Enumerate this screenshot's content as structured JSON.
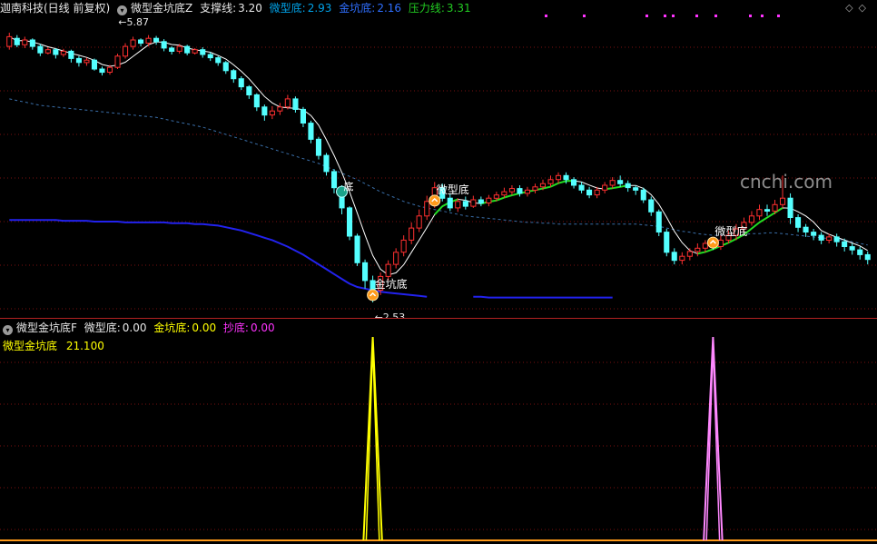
{
  "top_header": {
    "title": "迦南科技(日线 前复权)",
    "indicator_name": "微型金坑底Z",
    "support_label": "支撑线:",
    "support_value": "3.20",
    "micro_label": "微型底:",
    "micro_value": "2.93",
    "gold_label": "金坑底:",
    "gold_value": "2.16",
    "pressure_label": "压力线:",
    "pressure_value": "3.31"
  },
  "sub_header": {
    "indicator_name": "微型金坑底F",
    "micro_label": "微型底:",
    "micro_value": "0.00",
    "gold_label": "金坑底:",
    "gold_value": "0.00",
    "chaodi_label": "抄底:",
    "chaodi_value": "0.00",
    "series_label": "微型金坑底",
    "series_value": "21.100"
  },
  "annotations": {
    "high_price": "5.87",
    "low_price": "2.53",
    "signal_gold": "金坑底",
    "signal_micro_1": "微型底",
    "signal_micro_2": "微型底",
    "signal_kk": "底"
  },
  "nav": {
    "diamonds": "◇◇"
  },
  "watermark": "cnchi.com",
  "colors": {
    "background": "#000000",
    "grid": "#7a1010",
    "up_candle": "#ff3030",
    "down_candle": "#54ffff",
    "ma_white": "#ffffff",
    "ma_green": "#22dd22",
    "dashed_ma": "#3a6ea8",
    "blue_line": "#2222ee",
    "yellow": "#ffff00",
    "pink": "#ff88ff",
    "magenta": "#ff33ff",
    "support_color": "#e8e8e8",
    "micro_color": "#00a2e8",
    "gold_color": "#2f6fff",
    "pressure_color": "#22cc22"
  },
  "chart_data": [
    {
      "type": "candlestick",
      "title": "迦南科技(日线 前复权)",
      "price_range": [
        2.45,
        6.05
      ],
      "annotated_high": 5.87,
      "annotated_low": 2.53,
      "candles": [
        [
          5.7,
          5.82,
          5.66,
          5.87
        ],
        [
          5.8,
          5.72,
          5.69,
          5.84
        ],
        [
          5.72,
          5.78,
          5.68,
          5.82
        ],
        [
          5.78,
          5.7,
          5.66,
          5.8
        ],
        [
          5.7,
          5.62,
          5.58,
          5.73
        ],
        [
          5.62,
          5.66,
          5.6,
          5.69
        ],
        [
          5.66,
          5.6,
          5.55,
          5.68
        ],
        [
          5.6,
          5.64,
          5.57,
          5.67
        ],
        [
          5.64,
          5.55,
          5.5,
          5.66
        ],
        [
          5.55,
          5.5,
          5.45,
          5.58
        ],
        [
          5.5,
          5.53,
          5.46,
          5.56
        ],
        [
          5.53,
          5.42,
          5.4,
          5.55
        ],
        [
          5.42,
          5.38,
          5.34,
          5.45
        ],
        [
          5.38,
          5.44,
          5.35,
          5.47
        ],
        [
          5.44,
          5.58,
          5.42,
          5.61
        ],
        [
          5.58,
          5.7,
          5.55,
          5.74
        ],
        [
          5.7,
          5.78,
          5.66,
          5.82
        ],
        [
          5.78,
          5.74,
          5.7,
          5.8
        ],
        [
          5.74,
          5.8,
          5.7,
          5.84
        ],
        [
          5.8,
          5.76,
          5.72,
          5.83
        ],
        [
          5.76,
          5.68,
          5.64,
          5.79
        ],
        [
          5.68,
          5.64,
          5.6,
          5.7
        ],
        [
          5.64,
          5.7,
          5.61,
          5.73
        ],
        [
          5.7,
          5.62,
          5.59,
          5.72
        ],
        [
          5.62,
          5.66,
          5.6,
          5.68
        ],
        [
          5.66,
          5.6,
          5.56,
          5.69
        ],
        [
          5.6,
          5.56,
          5.52,
          5.63
        ],
        [
          5.56,
          5.5,
          5.46,
          5.58
        ],
        [
          5.5,
          5.4,
          5.36,
          5.52
        ],
        [
          5.4,
          5.3,
          5.25,
          5.42
        ],
        [
          5.3,
          5.2,
          5.16,
          5.33
        ],
        [
          5.2,
          5.1,
          5.05,
          5.22
        ],
        [
          5.1,
          4.95,
          4.9,
          5.12
        ],
        [
          4.95,
          4.85,
          4.78,
          4.98
        ],
        [
          4.85,
          4.9,
          4.8,
          4.96
        ],
        [
          4.9,
          4.95,
          4.85,
          5.0
        ],
        [
          4.95,
          5.05,
          4.92,
          5.1
        ],
        [
          5.05,
          4.92,
          4.88,
          5.08
        ],
        [
          4.92,
          4.75,
          4.7,
          4.95
        ],
        [
          4.75,
          4.55,
          4.5,
          4.78
        ],
        [
          4.55,
          4.35,
          4.3,
          4.58
        ],
        [
          4.35,
          4.15,
          4.1,
          4.38
        ],
        [
          4.15,
          3.95,
          3.88,
          4.18
        ],
        [
          3.95,
          3.7,
          3.62,
          3.98
        ],
        [
          3.7,
          3.35,
          3.3,
          3.72
        ],
        [
          3.35,
          3.02,
          2.98,
          3.38
        ],
        [
          3.02,
          2.8,
          2.7,
          3.06
        ],
        [
          2.8,
          2.68,
          2.53,
          2.86
        ],
        [
          2.68,
          2.85,
          2.62,
          2.9
        ],
        [
          2.85,
          3.0,
          2.8,
          3.05
        ],
        [
          3.0,
          3.15,
          2.95,
          3.2
        ],
        [
          3.15,
          3.3,
          3.1,
          3.36
        ],
        [
          3.3,
          3.45,
          3.25,
          3.52
        ],
        [
          3.45,
          3.6,
          3.4,
          3.68
        ],
        [
          3.6,
          3.78,
          3.55,
          3.85
        ],
        [
          3.78,
          3.95,
          3.7,
          4.02
        ],
        [
          3.95,
          3.82,
          3.78,
          4.0
        ],
        [
          3.82,
          3.7,
          3.66,
          3.88
        ],
        [
          3.7,
          3.78,
          3.65,
          3.82
        ],
        [
          3.78,
          3.72,
          3.68,
          3.84
        ],
        [
          3.72,
          3.8,
          3.7,
          3.85
        ],
        [
          3.8,
          3.76,
          3.72,
          3.84
        ],
        [
          3.76,
          3.82,
          3.72,
          3.86
        ],
        [
          3.82,
          3.86,
          3.78,
          3.9
        ],
        [
          3.86,
          3.9,
          3.82,
          3.95
        ],
        [
          3.9,
          3.94,
          3.86,
          3.98
        ],
        [
          3.94,
          3.88,
          3.84,
          3.98
        ],
        [
          3.88,
          3.92,
          3.84,
          3.96
        ],
        [
          3.92,
          3.96,
          3.88,
          4.0
        ],
        [
          3.96,
          4.0,
          3.92,
          4.05
        ],
        [
          4.0,
          4.05,
          3.96,
          4.1
        ],
        [
          4.05,
          4.1,
          4.0,
          4.14
        ],
        [
          4.1,
          4.05,
          4.0,
          4.14
        ],
        [
          4.05,
          3.98,
          3.94,
          4.08
        ],
        [
          3.98,
          3.92,
          3.88,
          4.02
        ],
        [
          3.92,
          3.86,
          3.82,
          3.96
        ],
        [
          3.86,
          3.92,
          3.82,
          3.96
        ],
        [
          3.92,
          3.98,
          3.88,
          4.02
        ],
        [
          3.98,
          4.04,
          3.94,
          4.08
        ],
        [
          4.04,
          4.0,
          3.96,
          4.1
        ],
        [
          4.0,
          3.95,
          3.9,
          4.04
        ],
        [
          3.95,
          3.92,
          3.86,
          3.98
        ],
        [
          3.92,
          3.8,
          3.76,
          3.95
        ],
        [
          3.8,
          3.65,
          3.6,
          3.84
        ],
        [
          3.65,
          3.4,
          3.35,
          3.68
        ],
        [
          3.4,
          3.15,
          3.1,
          3.44
        ],
        [
          3.15,
          3.05,
          3.0,
          3.2
        ],
        [
          3.05,
          3.1,
          3.0,
          3.15
        ],
        [
          3.1,
          3.16,
          3.05,
          3.2
        ],
        [
          3.16,
          3.2,
          3.1,
          3.26
        ],
        [
          3.2,
          3.26,
          3.15,
          3.3
        ],
        [
          3.26,
          3.22,
          3.18,
          3.32
        ],
        [
          3.22,
          3.3,
          3.18,
          3.36
        ],
        [
          3.3,
          3.36,
          3.26,
          3.42
        ],
        [
          3.36,
          3.44,
          3.3,
          3.5
        ],
        [
          3.44,
          3.52,
          3.4,
          3.58
        ],
        [
          3.52,
          3.6,
          3.48,
          3.66
        ],
        [
          3.6,
          3.68,
          3.55,
          3.74
        ],
        [
          3.68,
          3.66,
          3.6,
          3.74
        ],
        [
          3.66,
          3.74,
          3.62,
          3.8
        ],
        [
          3.74,
          3.82,
          3.7,
          4.1
        ],
        [
          3.82,
          3.58,
          3.5,
          3.88
        ],
        [
          3.58,
          3.46,
          3.4,
          3.62
        ],
        [
          3.46,
          3.4,
          3.34,
          3.5
        ],
        [
          3.4,
          3.36,
          3.3,
          3.44
        ],
        [
          3.36,
          3.3,
          3.25,
          3.4
        ],
        [
          3.3,
          3.34,
          3.26,
          3.38
        ],
        [
          3.34,
          3.28,
          3.22,
          3.38
        ],
        [
          3.28,
          3.22,
          3.16,
          3.32
        ],
        [
          3.22,
          3.18,
          3.12,
          3.26
        ],
        [
          3.18,
          3.12,
          3.06,
          3.22
        ],
        [
          3.12,
          3.06,
          3.0,
          3.16
        ]
      ],
      "ma_dashed": [
        5.05,
        5.03,
        5.01,
        4.99,
        4.97,
        4.96,
        4.95,
        4.94,
        4.93,
        4.92,
        4.91,
        4.9,
        4.89,
        4.88,
        4.87,
        4.86,
        4.85,
        4.84,
        4.83,
        4.82,
        4.8,
        4.78,
        4.76,
        4.74,
        4.72,
        4.7,
        4.67,
        4.64,
        4.61,
        4.58,
        4.55,
        4.52,
        4.49,
        4.46,
        4.43,
        4.4,
        4.37,
        4.34,
        4.31,
        4.28,
        4.25,
        4.21,
        4.17,
        4.13,
        4.09,
        4.05,
        4.0,
        3.95,
        3.9,
        3.86,
        3.82,
        3.78,
        3.75,
        3.72,
        3.7,
        3.68,
        3.66,
        3.64,
        3.62,
        3.6,
        3.59,
        3.58,
        3.57,
        3.56,
        3.55,
        3.54,
        3.53,
        3.52,
        3.52,
        3.51,
        3.51,
        3.5,
        3.5,
        3.5,
        3.5,
        3.5,
        3.5,
        3.5,
        3.5,
        3.5,
        3.5,
        3.5,
        3.49,
        3.48,
        3.47,
        3.45,
        3.43,
        3.41,
        3.4,
        3.38,
        3.37,
        3.36,
        3.36,
        3.36,
        3.36,
        3.37,
        3.38,
        3.38,
        3.39,
        3.39,
        3.38,
        3.37,
        3.36,
        3.35,
        3.34,
        3.33,
        3.32,
        3.31,
        3.3,
        3.28,
        3.26,
        3.24
      ],
      "blue_line": [
        3.55,
        3.55,
        3.55,
        3.55,
        3.55,
        3.55,
        3.55,
        3.54,
        3.54,
        3.54,
        3.54,
        3.53,
        3.53,
        3.53,
        3.53,
        3.52,
        3.52,
        3.52,
        3.52,
        3.52,
        3.52,
        3.51,
        3.51,
        3.51,
        3.5,
        3.5,
        3.49,
        3.48,
        3.46,
        3.44,
        3.42,
        3.39,
        3.36,
        3.33,
        3.3,
        3.26,
        3.22,
        3.17,
        3.12,
        3.06,
        3.0,
        2.94,
        2.88,
        2.82,
        2.76,
        2.72,
        2.7,
        2.68,
        2.66,
        2.65,
        2.64,
        2.63,
        2.62,
        2.61,
        2.6,
        null
      ],
      "blue_tail": [
        [
          60,
          2.6
        ],
        [
          61,
          2.6
        ],
        [
          62,
          2.59
        ],
        [
          63,
          2.59
        ],
        [
          64,
          2.59
        ],
        [
          65,
          2.59
        ],
        [
          66,
          2.59
        ],
        [
          67,
          2.59
        ],
        [
          68,
          2.59
        ],
        [
          69,
          2.59
        ],
        [
          70,
          2.59
        ],
        [
          71,
          2.59
        ],
        [
          72,
          2.59
        ],
        [
          73,
          2.59
        ],
        [
          74,
          2.59
        ],
        [
          75,
          2.59
        ],
        [
          76,
          2.59
        ],
        [
          77,
          2.59
        ],
        [
          78,
          2.59
        ]
      ],
      "signals": [
        {
          "index": 47,
          "label_key": "signal_gold"
        },
        {
          "index": 55,
          "label_key": "signal_micro_1"
        },
        {
          "index": 91,
          "label_key": "signal_micro_2"
        }
      ]
    },
    {
      "type": "line",
      "title": "微型金坑底F",
      "ylim": [
        0,
        21.1
      ],
      "series": [
        {
          "name": "金坑底",
          "color": "#ffff00",
          "peak_index": 47,
          "peak_value": 21.1
        },
        {
          "name": "抄底",
          "color": "#ff88ff",
          "peak_index": 91,
          "peak_value": 21.1
        }
      ]
    }
  ]
}
